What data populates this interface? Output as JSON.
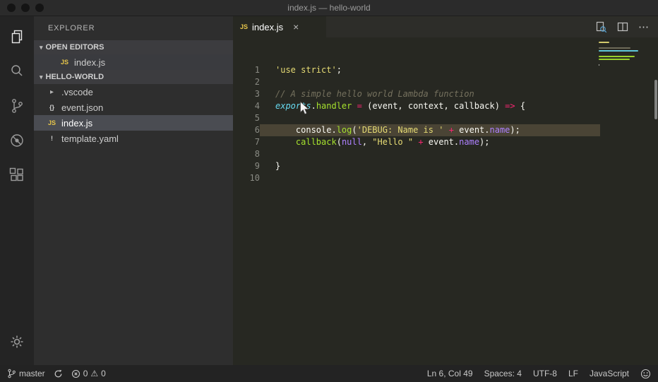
{
  "window": {
    "title": "index.js — hello-world"
  },
  "icons": {
    "js": "JS",
    "json": "{}",
    "yaml": "!",
    "close": "×",
    "ellipsis": "⋯",
    "chevron_down": "▾",
    "chevron_right": "▸",
    "warning": "⚠"
  },
  "activity_bar": {
    "items": [
      "explorer",
      "search",
      "source-control",
      "debug",
      "extensions"
    ],
    "bottom_items": [
      "settings"
    ]
  },
  "sidebar": {
    "title": "EXPLORER",
    "sections": [
      {
        "label": "OPEN EDITORS"
      },
      {
        "label": "HELLO-WORLD"
      }
    ],
    "open_editors": [
      {
        "name": "index.js",
        "icon": "js",
        "active": true
      }
    ],
    "files": [
      {
        "name": ".vscode",
        "icon": "folder"
      },
      {
        "name": "event.json",
        "icon": "json"
      },
      {
        "name": "index.js",
        "icon": "js",
        "selected": true
      },
      {
        "name": "template.yaml",
        "icon": "yaml"
      }
    ]
  },
  "editor": {
    "tabs": [
      {
        "label": "index.js",
        "icon": "js",
        "active": true
      }
    ],
    "code": {
      "language": "javascript",
      "lines": [
        {
          "num": 1,
          "tokens": [
            [
              "str",
              "'use strict'"
            ],
            [
              "plain",
              ";"
            ]
          ]
        },
        {
          "num": 2,
          "tokens": []
        },
        {
          "num": 3,
          "tokens": [
            [
              "cmt",
              "// A simple hello world Lambda function"
            ]
          ]
        },
        {
          "num": 4,
          "tokens": [
            [
              "type",
              "exports"
            ],
            [
              "plain",
              "."
            ],
            [
              "fn",
              "handler"
            ],
            [
              "plain",
              " "
            ],
            [
              "kw",
              "="
            ],
            [
              "plain",
              " ("
            ],
            [
              "plain",
              "event, context, callback"
            ],
            [
              "plain",
              ") "
            ],
            [
              "kw",
              "=>"
            ],
            [
              "plain",
              " {"
            ]
          ]
        },
        {
          "num": 5,
          "tokens": []
        },
        {
          "num": 6,
          "highlight": true,
          "tokens": [
            [
              "plain",
              "    console."
            ],
            [
              "fn",
              "log"
            ],
            [
              "plain",
              "("
            ],
            [
              "str",
              "'DEBUG: Name is '"
            ],
            [
              "plain",
              " "
            ],
            [
              "kw",
              "+"
            ],
            [
              "plain",
              " event."
            ],
            [
              "const",
              "name"
            ],
            [
              "plain",
              ");"
            ]
          ]
        },
        {
          "num": 7,
          "tokens": [
            [
              "plain",
              "    "
            ],
            [
              "fn",
              "callback"
            ],
            [
              "plain",
              "("
            ],
            [
              "const",
              "null"
            ],
            [
              "plain",
              ", "
            ],
            [
              "str",
              "\"Hello \""
            ],
            [
              "plain",
              " "
            ],
            [
              "kw",
              "+"
            ],
            [
              "plain",
              " event."
            ],
            [
              "const",
              "name"
            ],
            [
              "plain",
              ");"
            ]
          ]
        },
        {
          "num": 8,
          "tokens": []
        },
        {
          "num": 9,
          "tokens": [
            [
              "plain",
              "}"
            ]
          ]
        },
        {
          "num": 10,
          "tokens": []
        }
      ]
    }
  },
  "status_bar": {
    "branch": "master",
    "errors": "0",
    "warnings": "0",
    "cursor_position": "Ln 6, Col 49",
    "indentation": "Spaces: 4",
    "encoding": "UTF-8",
    "eol": "LF",
    "language": "JavaScript"
  },
  "colors": {
    "js_icon": "#e6c54a",
    "line_highlight": "#4a4435",
    "blue_accent": "#58a6d6",
    "tokens": {
      "plain": "#f8f8f2",
      "str": "#e6db74",
      "cmt": "#75715e",
      "kw": "#f92672",
      "fn": "#a6e22e",
      "type": "#66d9ef",
      "const": "#ae81ff"
    },
    "italic_tokens": [
      "cmt",
      "type"
    ]
  }
}
